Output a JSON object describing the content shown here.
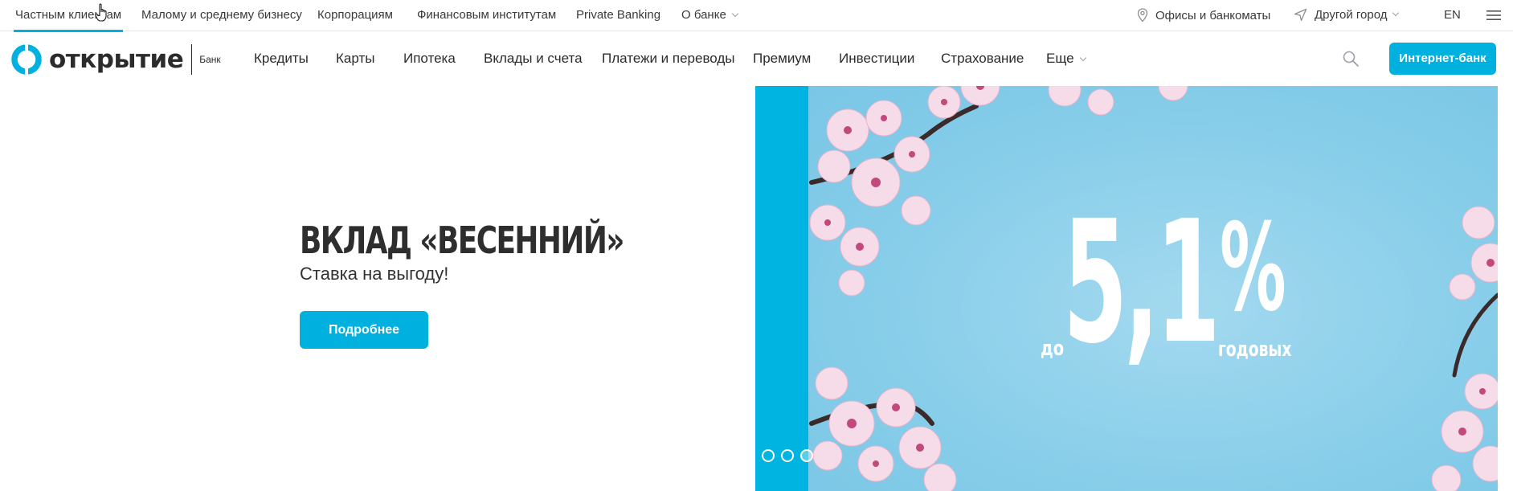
{
  "topbar": {
    "segments": [
      {
        "label": "Частным клиентам"
      },
      {
        "label": "Малому и среднему бизнесу"
      },
      {
        "label": "Корпорациям"
      },
      {
        "label": "Финансовым институтам"
      },
      {
        "label": "Private Banking"
      },
      {
        "label": "О банке"
      }
    ],
    "offices_label": "Офисы и банкоматы",
    "city_label": "Другой город",
    "lang_label": "EN"
  },
  "nav": {
    "logo_text": "открытие",
    "logo_sub": "Банк",
    "items": [
      {
        "label": "Кредиты"
      },
      {
        "label": "Карты"
      },
      {
        "label": "Ипотека"
      },
      {
        "label": "Вклады и счета"
      },
      {
        "label": "Платежи и переводы"
      },
      {
        "label": "Премиум"
      },
      {
        "label": "Инвестиции"
      },
      {
        "label": "Страхование"
      },
      {
        "label": "Еще"
      }
    ],
    "internet_bank_label": "Интернет-банк"
  },
  "promo": {
    "title": "ВКЛАД «ВЕСЕННИЙ»",
    "subtitle": "Ставка на выгоду!",
    "button_label": "Подробнее"
  },
  "banner": {
    "prefix": "до",
    "rate": "5,1",
    "percent": "%",
    "suffix": "годовых",
    "slides_total": 3,
    "slide_active": 1
  },
  "colors": {
    "accent": "#00b1e0",
    "banner_sky": "#8ecfe8",
    "blossom": "#f3d3e4"
  }
}
